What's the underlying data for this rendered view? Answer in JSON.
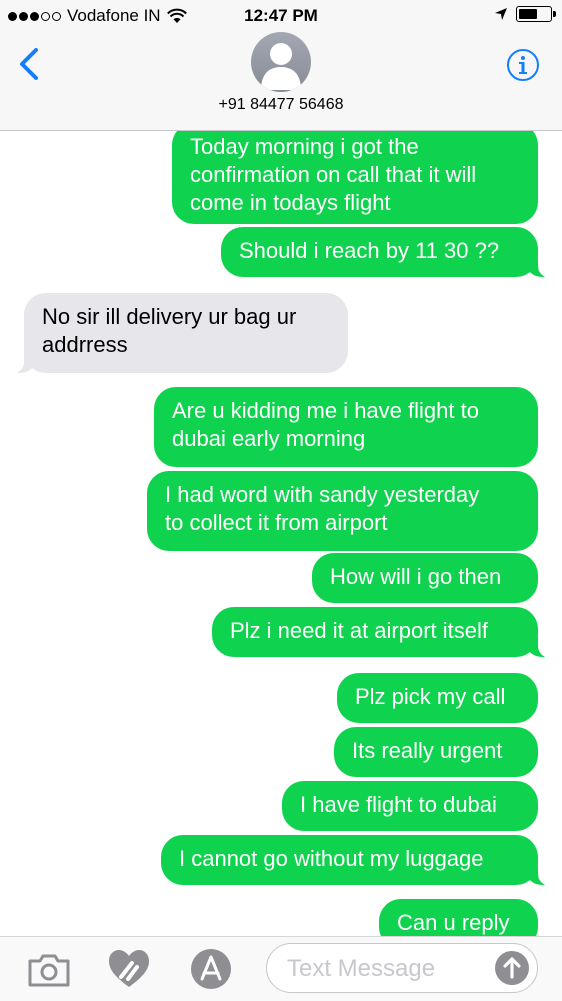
{
  "status_bar": {
    "carrier": "Vodafone IN",
    "time": "12:47 PM",
    "signal_bars": 3,
    "signal_total": 5,
    "battery_level": 0.65
  },
  "header": {
    "contact_number": "+91 84477 56468",
    "icons": {
      "back": "chevron-left-icon",
      "avatar": "person-icon",
      "info": "info-icon"
    }
  },
  "messages": [
    {
      "direction": "outgoing",
      "text": "Today morning i got the\nconfirmation on call that it will\ncome in todays flight"
    },
    {
      "direction": "outgoing",
      "text": "Should i reach by 11 30 ??"
    },
    {
      "direction": "incoming",
      "text": "No sir ill delivery ur bag ur\naddrress"
    },
    {
      "direction": "outgoing",
      "text": "Are u kidding me i have flight to\ndubai early morning"
    },
    {
      "direction": "outgoing",
      "text": "I had word with sandy yesterday\nto collect it from airport"
    },
    {
      "direction": "outgoing",
      "text": "How will i go then"
    },
    {
      "direction": "outgoing",
      "text": "Plz i need it at airport itself"
    },
    {
      "direction": "outgoing",
      "text": "Plz pick my call"
    },
    {
      "direction": "outgoing",
      "text": "Its really urgent"
    },
    {
      "direction": "outgoing",
      "text": "I have flight to dubai"
    },
    {
      "direction": "outgoing",
      "text": "I cannot go without my luggage"
    },
    {
      "direction": "outgoing",
      "text": "Can u reply"
    }
  ],
  "input_bar": {
    "placeholder": "Text Message",
    "value": "",
    "icons": [
      "camera-icon",
      "digital-touch-icon",
      "app-store-icon",
      "send-arrow-icon"
    ]
  },
  "colors": {
    "outgoing_bubble": "#0fd24e",
    "incoming_bubble": "#e6e6eb",
    "accent": "#157efb"
  }
}
